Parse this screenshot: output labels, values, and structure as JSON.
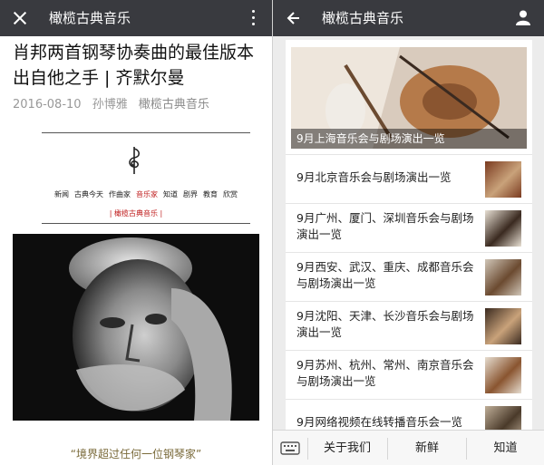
{
  "left": {
    "topbar_title": "橄榄古典音乐",
    "article_title": "肖邦两首钢琴协奏曲的最佳版本出自他之手 | 齐默尔曼",
    "meta": {
      "date": "2016-08-10",
      "author": "孙博雅",
      "account": "橄榄古典音乐"
    },
    "categories": [
      "新闻",
      "古典今天",
      "作曲家",
      "音乐家",
      "知道",
      "剧界",
      "教育",
      "欣赏"
    ],
    "active_category": "音乐家",
    "brand_tag": "| 橄榄古典音乐 |",
    "quote": "“境界超过任何一位钢琴家”"
  },
  "right": {
    "topbar_title": "橄榄古典音乐",
    "hero_caption": "9月上海音乐会与剧场演出一览",
    "items": [
      "9月北京音乐会与剧场演出一览",
      "9月广州、厦门、深圳音乐会与剧场演出一览",
      "9月西安、武汉、重庆、成都音乐会与剧场演出一览",
      "9月沈阳、天津、长沙音乐会与剧场演出一览",
      "9月苏州、杭州、常州、南京音乐会与剧场演出一览",
      "9月网络视频在线转播音乐会一览"
    ],
    "bottom_menu": [
      "关于我们",
      "新鲜",
      "知道"
    ]
  },
  "colors": {
    "topbar": "#393a3f",
    "accent_red": "#c02020",
    "quote_gold": "#7a6a3a",
    "meta_gray": "#999999"
  },
  "icons": {
    "left_close": "close-icon",
    "left_more": "more-icon",
    "right_back": "back-arrow-icon",
    "right_profile": "profile-icon",
    "keyboard": "keyboard-icon",
    "clef": "clef-icon"
  }
}
